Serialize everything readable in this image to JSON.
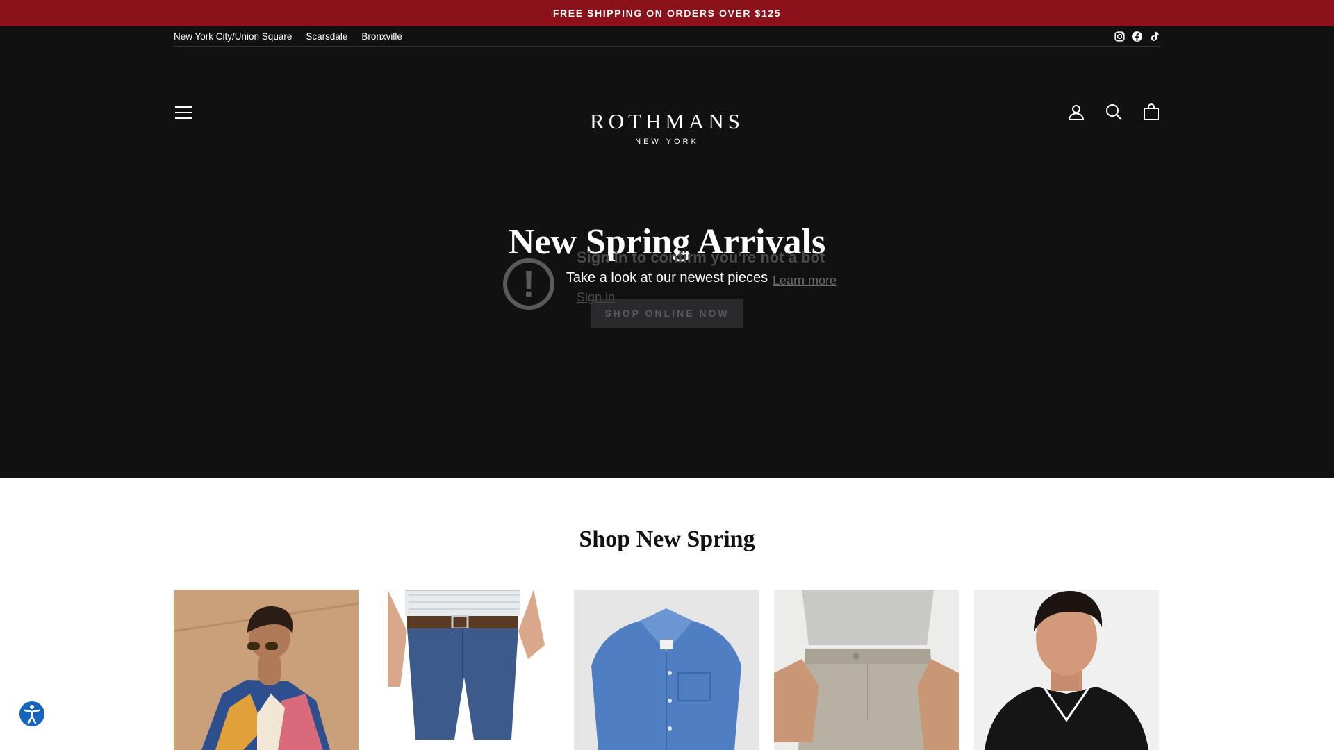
{
  "promo": {
    "text": "FREE SHIPPING ON ORDERS OVER $125"
  },
  "utility": {
    "locations": [
      "New York City/Union Square",
      "Scarsdale",
      "Bronxville"
    ],
    "socials": [
      "instagram-icon",
      "facebook-icon",
      "tiktok-icon"
    ]
  },
  "logo": {
    "main": "ROTHMANS",
    "sub": "NEW YORK"
  },
  "nav": {
    "icons": [
      "menu-icon",
      "account-icon",
      "search-icon",
      "cart-icon"
    ]
  },
  "hero": {
    "title": "New Spring Arrivals",
    "subtitle": "Take a look at our newest pieces",
    "button": "SHOP ONLINE NOW"
  },
  "overlay": {
    "message": "Sign in to confirm you're not a bot",
    "learn_more": "Learn more",
    "sign_in": "Sign in"
  },
  "section": {
    "title": "Shop New Spring"
  },
  "colors": {
    "promo_bg": "#8b111a",
    "header_bg": "#111112",
    "accessibility_blue": "#1565c0"
  }
}
